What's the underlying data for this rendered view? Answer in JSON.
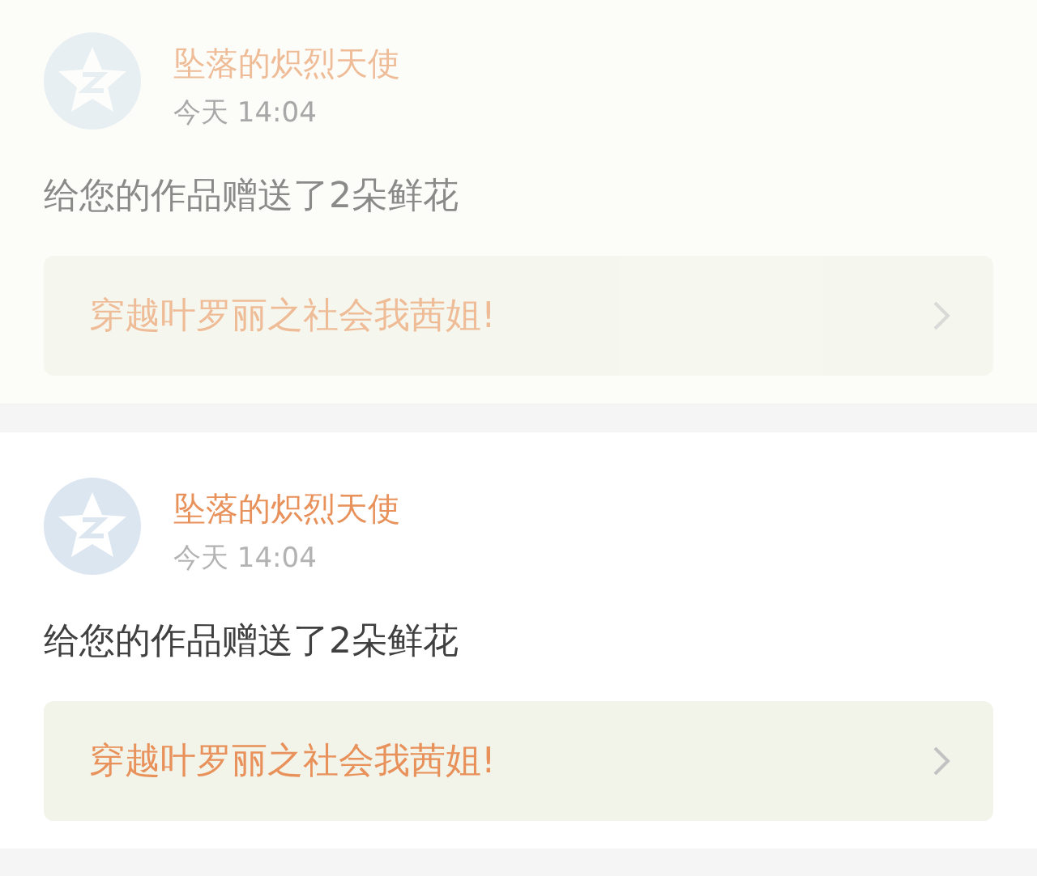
{
  "notifications": [
    {
      "user": "坠落的炽烈天使",
      "time": "今天 14:04",
      "message": "给您的作品赠送了2朵鲜花",
      "work_title": "穿越叶罗丽之社会我茜姐!",
      "dimmed": true
    },
    {
      "user": "坠落的炽烈天使",
      "time": "今天 14:04",
      "message": "给您的作品赠送了2朵鲜花",
      "work_title": "穿越叶罗丽之社会我茜姐!",
      "dimmed": false
    }
  ]
}
